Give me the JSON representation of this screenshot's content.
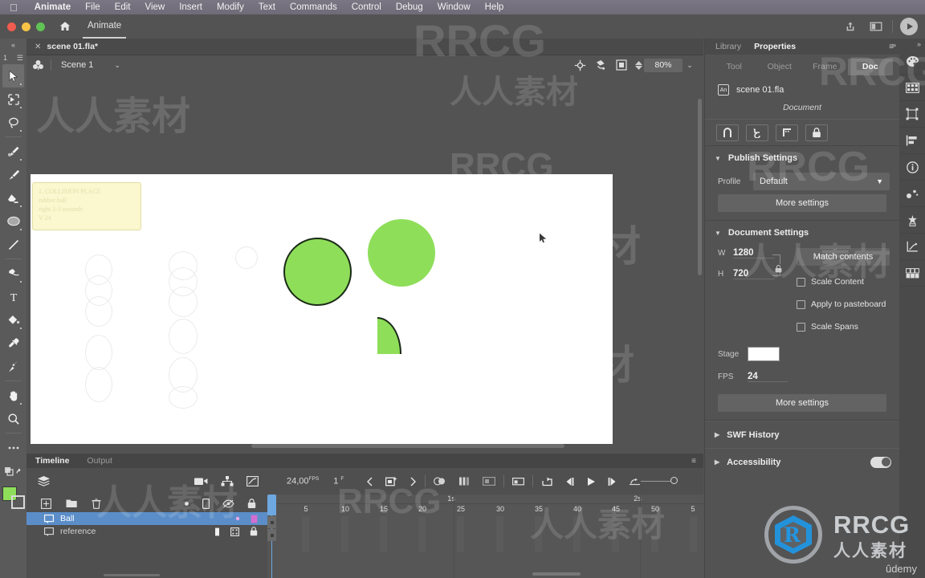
{
  "os_menu": {
    "apple_icon": "apple-icon",
    "items": [
      {
        "label": "Animate",
        "bold": true
      },
      {
        "label": "File",
        "bold": false
      },
      {
        "label": "Edit",
        "bold": false
      },
      {
        "label": "View",
        "bold": false
      },
      {
        "label": "Insert",
        "bold": false
      },
      {
        "label": "Modify",
        "bold": false
      },
      {
        "label": "Text",
        "bold": false
      },
      {
        "label": "Commands",
        "bold": false
      },
      {
        "label": "Control",
        "bold": false
      },
      {
        "label": "Debug",
        "bold": false
      },
      {
        "label": "Window",
        "bold": false
      },
      {
        "label": "Help",
        "bold": false
      }
    ]
  },
  "window": {
    "app_tab_label": "Animate",
    "home_icon": "home-icon",
    "share_icon": "share-icon",
    "layout_icon": "workspace-icon",
    "play_icon": "test-movie-icon"
  },
  "document_tab": {
    "close_icon": "close-icon",
    "filename": "scene 01.fla*"
  },
  "scene_bar": {
    "scene_icon": "scene-symbol-icon",
    "scene_name": "Scene 1",
    "caret": "⌄",
    "center_icon": "center-stage-icon",
    "rotate_icon": "rotate-stage-icon",
    "clip_icon": "clip-content-icon",
    "zoom_value": "80%",
    "zoom_caret": "⌄"
  },
  "toolbar": {
    "collapse_icon": "collapse-panel-icon",
    "layer_count": "1",
    "menu_icon": "tool-menu-icon",
    "tools": [
      {
        "name": "selection-tool",
        "active": true
      },
      {
        "name": "free-transform-tool",
        "active": false
      },
      {
        "name": "lasso-tool",
        "active": false
      },
      {
        "name": "pen-tool",
        "active": false
      },
      {
        "name": "brush-tool",
        "active": false
      },
      {
        "name": "eraser-tool",
        "active": false
      },
      {
        "name": "oval-tool",
        "active": false
      },
      {
        "name": "line-tool",
        "active": false
      },
      {
        "name": "paint-bucket-tool",
        "active": false
      },
      {
        "name": "text-tool",
        "active": false
      },
      {
        "name": "ink-bottle-tool",
        "active": false
      },
      {
        "name": "eyedropper-tool",
        "active": false
      },
      {
        "name": "bone-tool",
        "active": false
      },
      {
        "name": "hand-tool",
        "active": false
      },
      {
        "name": "zoom-tool",
        "active": false
      },
      {
        "name": "more-tools-icon",
        "active": false
      }
    ],
    "fill_color": "#8ede5a",
    "stroke_color": "#ffffff"
  },
  "canvas": {
    "note": {
      "lines": [
        "1. COLLISION PLACE",
        "rubber ball",
        "right 2-3 seconds",
        "V 24"
      ]
    },
    "shapes": [
      {
        "name": "ball-with-outline",
        "color": "#8ede5a",
        "outline": "#1b2b17"
      },
      {
        "name": "ball-no-outline",
        "color": "#8ede5a"
      },
      {
        "name": "ball-quarter-shape",
        "color": "#8ede5a",
        "outline": "#1b2b17"
      }
    ],
    "cursor": "arrow-cursor"
  },
  "timeline": {
    "tabs": [
      {
        "label": "Timeline",
        "active": true
      },
      {
        "label": "Output",
        "active": false
      }
    ],
    "panel_menu_icon": "panel-menu-icon",
    "stack_icon": "layer-depth-icon",
    "camera_icon": "camera-icon",
    "parent_icon": "parent-layer-icon",
    "graph_icon": "graph-editor-icon",
    "fps_value": "24,00",
    "fps_unit": "FPS",
    "frame_value": "1",
    "frame_unit": "F",
    "controls": {
      "prev_keyframe": "prev-keyframe-icon",
      "insert_keyframe": "insert-keyframe-icon",
      "next_keyframe": "next-keyframe-icon",
      "onion_skin": "onion-skin-icon",
      "onion_outline": "onion-skin-outline-icon",
      "edit_multiple": "edit-multiple-frames-icon",
      "anchor_onion": "anchor-onion-icon",
      "loop": "loop-playback-icon",
      "step_back": "step-back-icon",
      "play": "play-icon",
      "step_forward": "step-forward-icon",
      "loop_range": "loop-range-icon",
      "zoom_slider": "timeline-zoom-slider"
    },
    "layer_header": {
      "add_layer": "add-layer-icon",
      "add_folder": "add-folder-icon",
      "delete_layer": "delete-layer-icon",
      "dot_icon": "outline-color-icon",
      "lock_icon": "lock-all-icon",
      "eye_icon": "hide-all-icon",
      "shield_icon": "lock-column-icon"
    },
    "layers": [
      {
        "name": "Ball",
        "selected": true,
        "icon": "layer-icon"
      },
      {
        "name": "reference",
        "selected": false,
        "icon": "layer-icon"
      }
    ],
    "ruler": {
      "frame_ticks": [
        "5",
        "10",
        "15",
        "20",
        "25",
        "30",
        "35",
        "40",
        "45",
        "50",
        "5"
      ],
      "second_marks": [
        "1s",
        "2s"
      ]
    }
  },
  "properties": {
    "panel_tabs": [
      {
        "label": "Library",
        "active": false
      },
      {
        "label": "Properties",
        "active": true
      }
    ],
    "panel_menu_icon": "panel-options-icon",
    "expand_icon": "expand-icon",
    "segments": [
      {
        "label": "Tool",
        "active": false
      },
      {
        "label": "Object",
        "active": false
      },
      {
        "label": "Frame",
        "active": false
      },
      {
        "label": "Doc",
        "active": true
      }
    ],
    "file_badge": "An",
    "filename": "scene 01.fla",
    "subtitle": "Document",
    "quick_buttons": [
      {
        "name": "snap-to-objects-icon"
      },
      {
        "name": "snap-to-guides-icon"
      },
      {
        "name": "snap-align-icon"
      },
      {
        "name": "lock-guides-icon"
      }
    ],
    "publish_settings": {
      "title": "Publish Settings",
      "expanded": true,
      "profile_label": "Profile",
      "profile_value": "Default",
      "more_settings": "More settings"
    },
    "document_settings": {
      "title": "Document Settings",
      "expanded": true,
      "width_label": "W",
      "width_value": "1280",
      "height_label": "H",
      "height_value": "720",
      "lock_icon": "link-dimensions-lock-icon",
      "match_contents": "Match contents",
      "stage_label": "Stage",
      "stage_color": "#ffffff",
      "fps_label": "FPS",
      "fps_value": "24",
      "checkboxes": [
        {
          "label": "Scale Content",
          "checked": false
        },
        {
          "label": "Apply to pasteboard",
          "checked": false
        },
        {
          "label": "Scale Spans",
          "checked": false
        }
      ],
      "more_settings": "More settings"
    },
    "collapsed_sections": [
      {
        "title": "SWF History",
        "has_toggle": false
      },
      {
        "title": "Accessibility",
        "has_toggle": true,
        "toggle_on": true
      }
    ]
  },
  "icon_rail": {
    "top_icon": "chevrons-icon",
    "items": [
      {
        "name": "color-palette-icon"
      },
      {
        "name": "swatches-icon"
      },
      {
        "name": "transform-icon"
      },
      {
        "name": "align-icon"
      },
      {
        "name": "info-icon"
      },
      {
        "name": "motion-presets-icon"
      },
      {
        "name": "assets-icon"
      },
      {
        "name": "graph-editor-icon"
      },
      {
        "name": "components-icon"
      }
    ]
  },
  "watermarks": {
    "brand": "RRCG",
    "brand_cn": "人人素材",
    "udemy": "ûdemy"
  }
}
